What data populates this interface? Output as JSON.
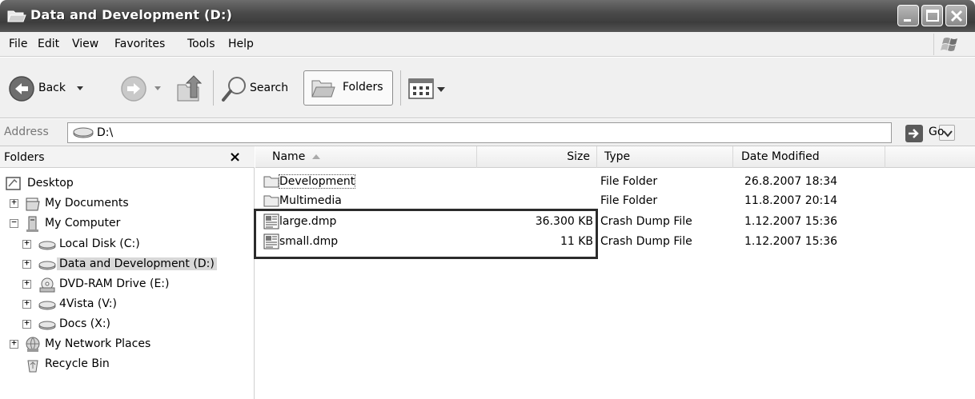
{
  "window": {
    "title": "Data and Development (D:)"
  },
  "menu": [
    "File",
    "Edit",
    "View",
    "Favorites",
    "Tools",
    "Help"
  ],
  "toolbar": {
    "back_label": "Back",
    "search_label": "Search",
    "folders_label": "Folders"
  },
  "address": {
    "label": "Address",
    "value": "D:\\",
    "go_label": "Go"
  },
  "folders_pane": {
    "title": "Folders",
    "close_glyph": "×",
    "items": [
      {
        "label": "Desktop",
        "icon": "desktop-icon",
        "expander": ""
      },
      {
        "label": "My Documents",
        "icon": "documents-icon",
        "expander": "+"
      },
      {
        "label": "My Computer",
        "icon": "computer-icon",
        "expander": "−"
      },
      {
        "label": "Local Disk (C:)",
        "icon": "drive-icon",
        "expander": "+"
      },
      {
        "label": "Data and Development (D:)",
        "icon": "drive-icon",
        "expander": "+"
      },
      {
        "label": "DVD-RAM Drive (E:)",
        "icon": "dvd-icon",
        "expander": "+"
      },
      {
        "label": "4Vista (V:)",
        "icon": "drive-icon",
        "expander": "+"
      },
      {
        "label": "Docs (X:)",
        "icon": "drive-icon",
        "expander": "+"
      },
      {
        "label": "My Network Places",
        "icon": "network-icon",
        "expander": "+"
      },
      {
        "label": "Recycle Bin",
        "icon": "recycle-bin-icon",
        "expander": ""
      }
    ]
  },
  "file_list": {
    "columns": [
      "Name",
      "Size",
      "Type",
      "Date Modified"
    ],
    "rows": [
      {
        "name": "Development",
        "size": "",
        "type": "File Folder",
        "modified": "26.8.2007 18:34",
        "icon": "folder-icon"
      },
      {
        "name": "Multimedia",
        "size": "",
        "type": "File Folder",
        "modified": "11.8.2007 20:14",
        "icon": "folder-icon"
      },
      {
        "name": "large.dmp",
        "size": "36.300 KB",
        "type": "Crash Dump File",
        "modified": "1.12.2007 15:36",
        "icon": "dump-file-icon"
      },
      {
        "name": "small.dmp",
        "size": "11 KB",
        "type": "Crash Dump File",
        "modified": "1.12.2007 15:36",
        "icon": "dump-file-icon"
      }
    ]
  }
}
